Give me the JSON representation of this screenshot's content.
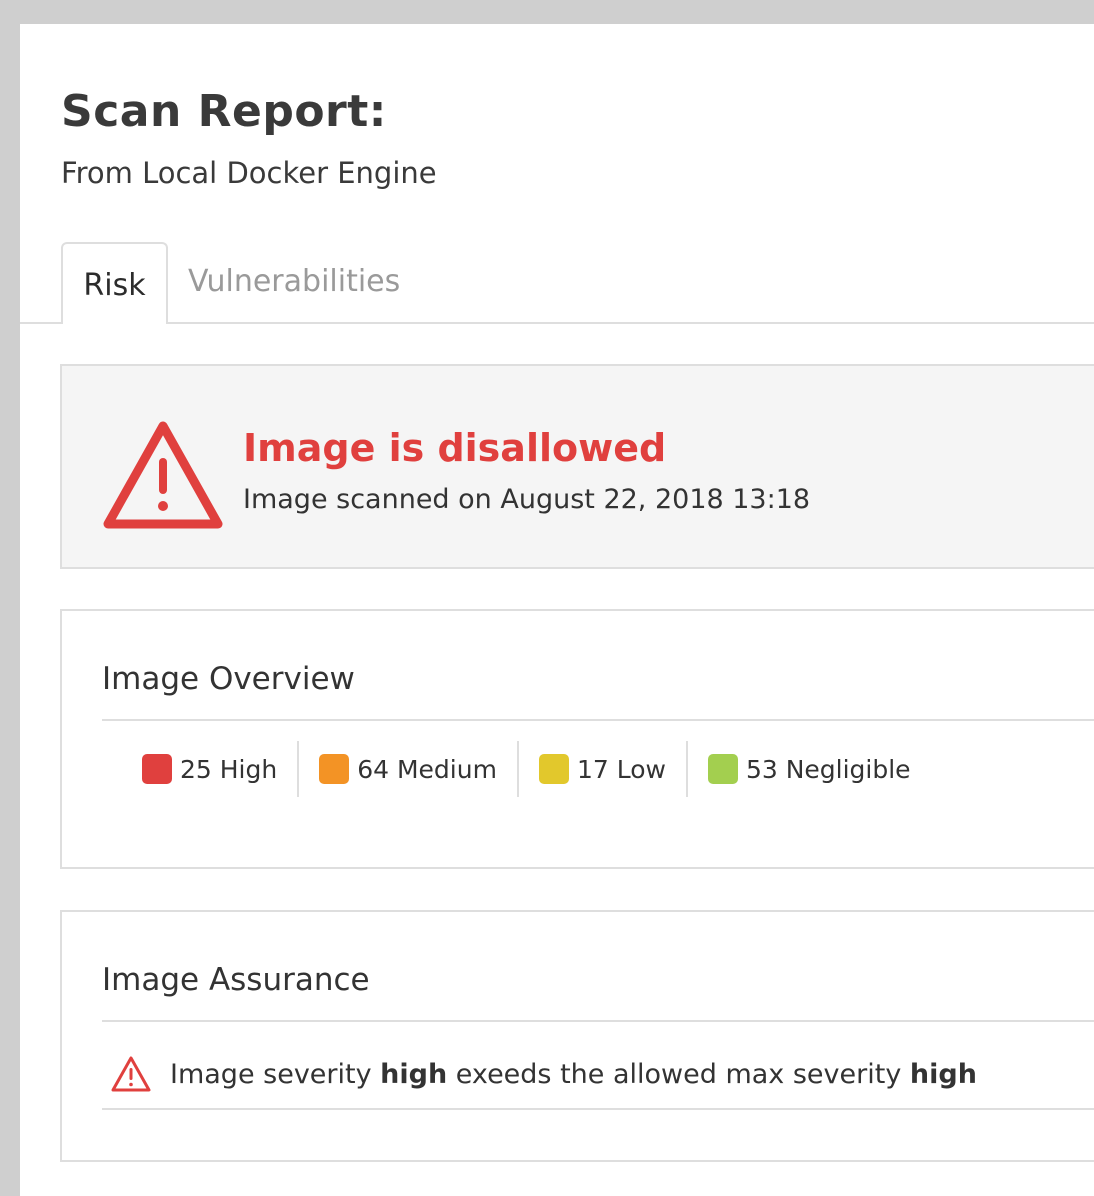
{
  "header": {
    "title": "Scan Report:",
    "subtitle": "From Local Docker Engine"
  },
  "tabs": [
    {
      "label": "Risk",
      "active": true
    },
    {
      "label": "Vulnerabilities",
      "active": false
    }
  ],
  "alert": {
    "icon": "warning-triangle-icon",
    "title": "Image is disallowed",
    "subtitle": "Image scanned on August 22, 2018 13:18",
    "color": "#e0403e"
  },
  "overview": {
    "title": "Image Overview",
    "severities": [
      {
        "label": "25 High",
        "color": "#e0403e"
      },
      {
        "label": "64 Medium",
        "color": "#f39325"
      },
      {
        "label": "17 Low",
        "color": "#e2c82c"
      },
      {
        "label": "53 Negligible",
        "color": "#a3cf4f"
      }
    ]
  },
  "assurance": {
    "title": "Image Assurance",
    "icon": "warning-triangle-icon",
    "message_prefix": "Image severity ",
    "message_severity": "high",
    "message_middle": " exeeds the allowed max severity ",
    "message_max": "high"
  }
}
